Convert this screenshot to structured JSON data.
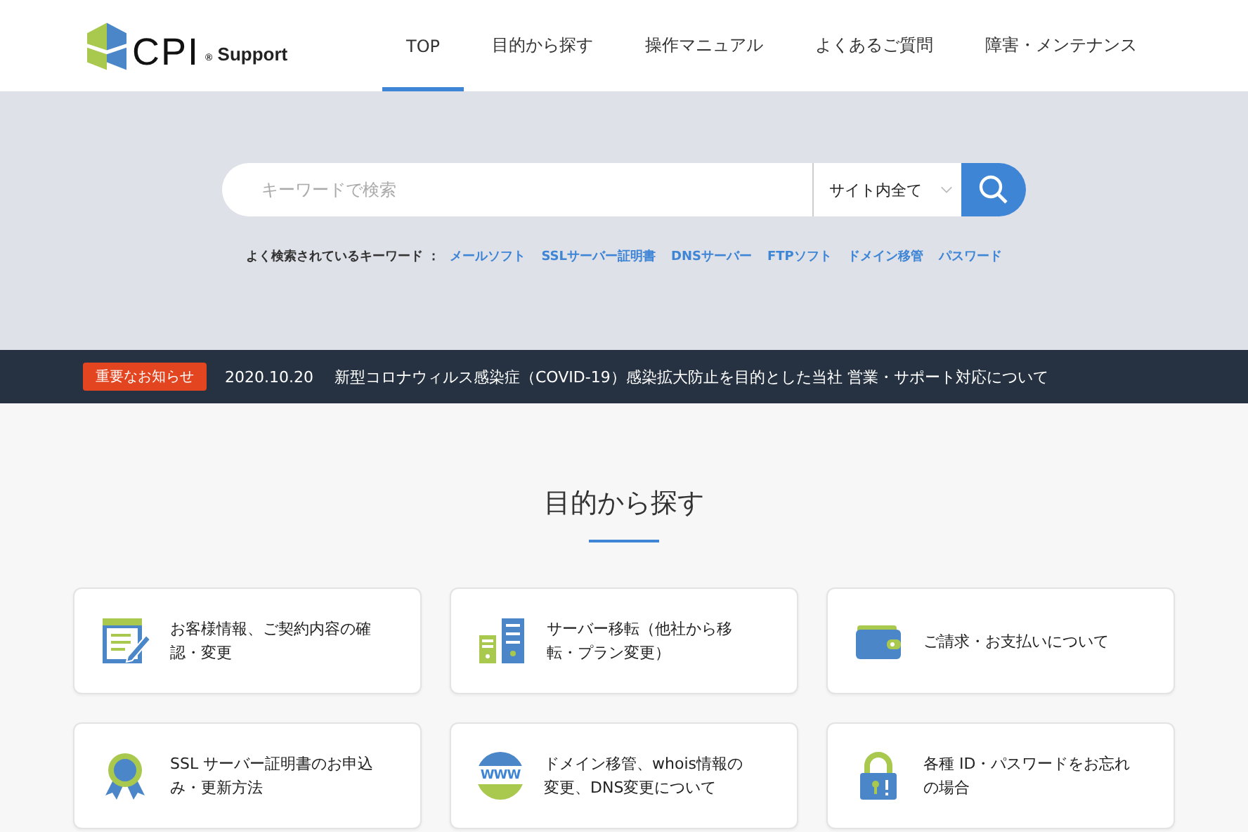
{
  "logo": {
    "brand": "CPI",
    "mark": "®",
    "product": "Support"
  },
  "nav": [
    {
      "label": "TOP",
      "selected": true
    },
    {
      "label": "目的から探す",
      "selected": false
    },
    {
      "label": "操作マニュアル",
      "selected": false
    },
    {
      "label": "よくあるご質問",
      "selected": false
    },
    {
      "label": "障害・メンテナンス",
      "selected": false
    }
  ],
  "search": {
    "placeholder": "キーワードで検索",
    "scope": "サイト内全て",
    "popular_label": "よく検索されているキーワード ：",
    "keywords": [
      "メールソフト",
      "SSLサーバー証明書",
      "DNSサーバー",
      "FTPソフト",
      "ドメイン移管",
      "パスワード"
    ]
  },
  "notice": {
    "badge": "重要なお知らせ",
    "date": "2020.10.20",
    "text": "新型コロナウィルス感染症（COVID-19）感染拡大防止を目的とした当社 営業・サポート対応について"
  },
  "section": {
    "title": "目的から探す",
    "cards": [
      {
        "kind": "form",
        "label": "お客様情報、ご契約内容の確認・変更"
      },
      {
        "kind": "servers",
        "label": "サーバー移転（他社から移転・プラン変更）"
      },
      {
        "kind": "wallet",
        "label": "ご請求・お支払いについて"
      },
      {
        "kind": "award",
        "label": "SSL サーバー証明書のお申込み・更新方法"
      },
      {
        "kind": "globe",
        "label": "ドメイン移管、whois情報の変更、DNS変更について",
        "icon_text": "WWW"
      },
      {
        "kind": "lock",
        "label": "各種 ID・パスワードをお忘れの場合"
      }
    ]
  }
}
